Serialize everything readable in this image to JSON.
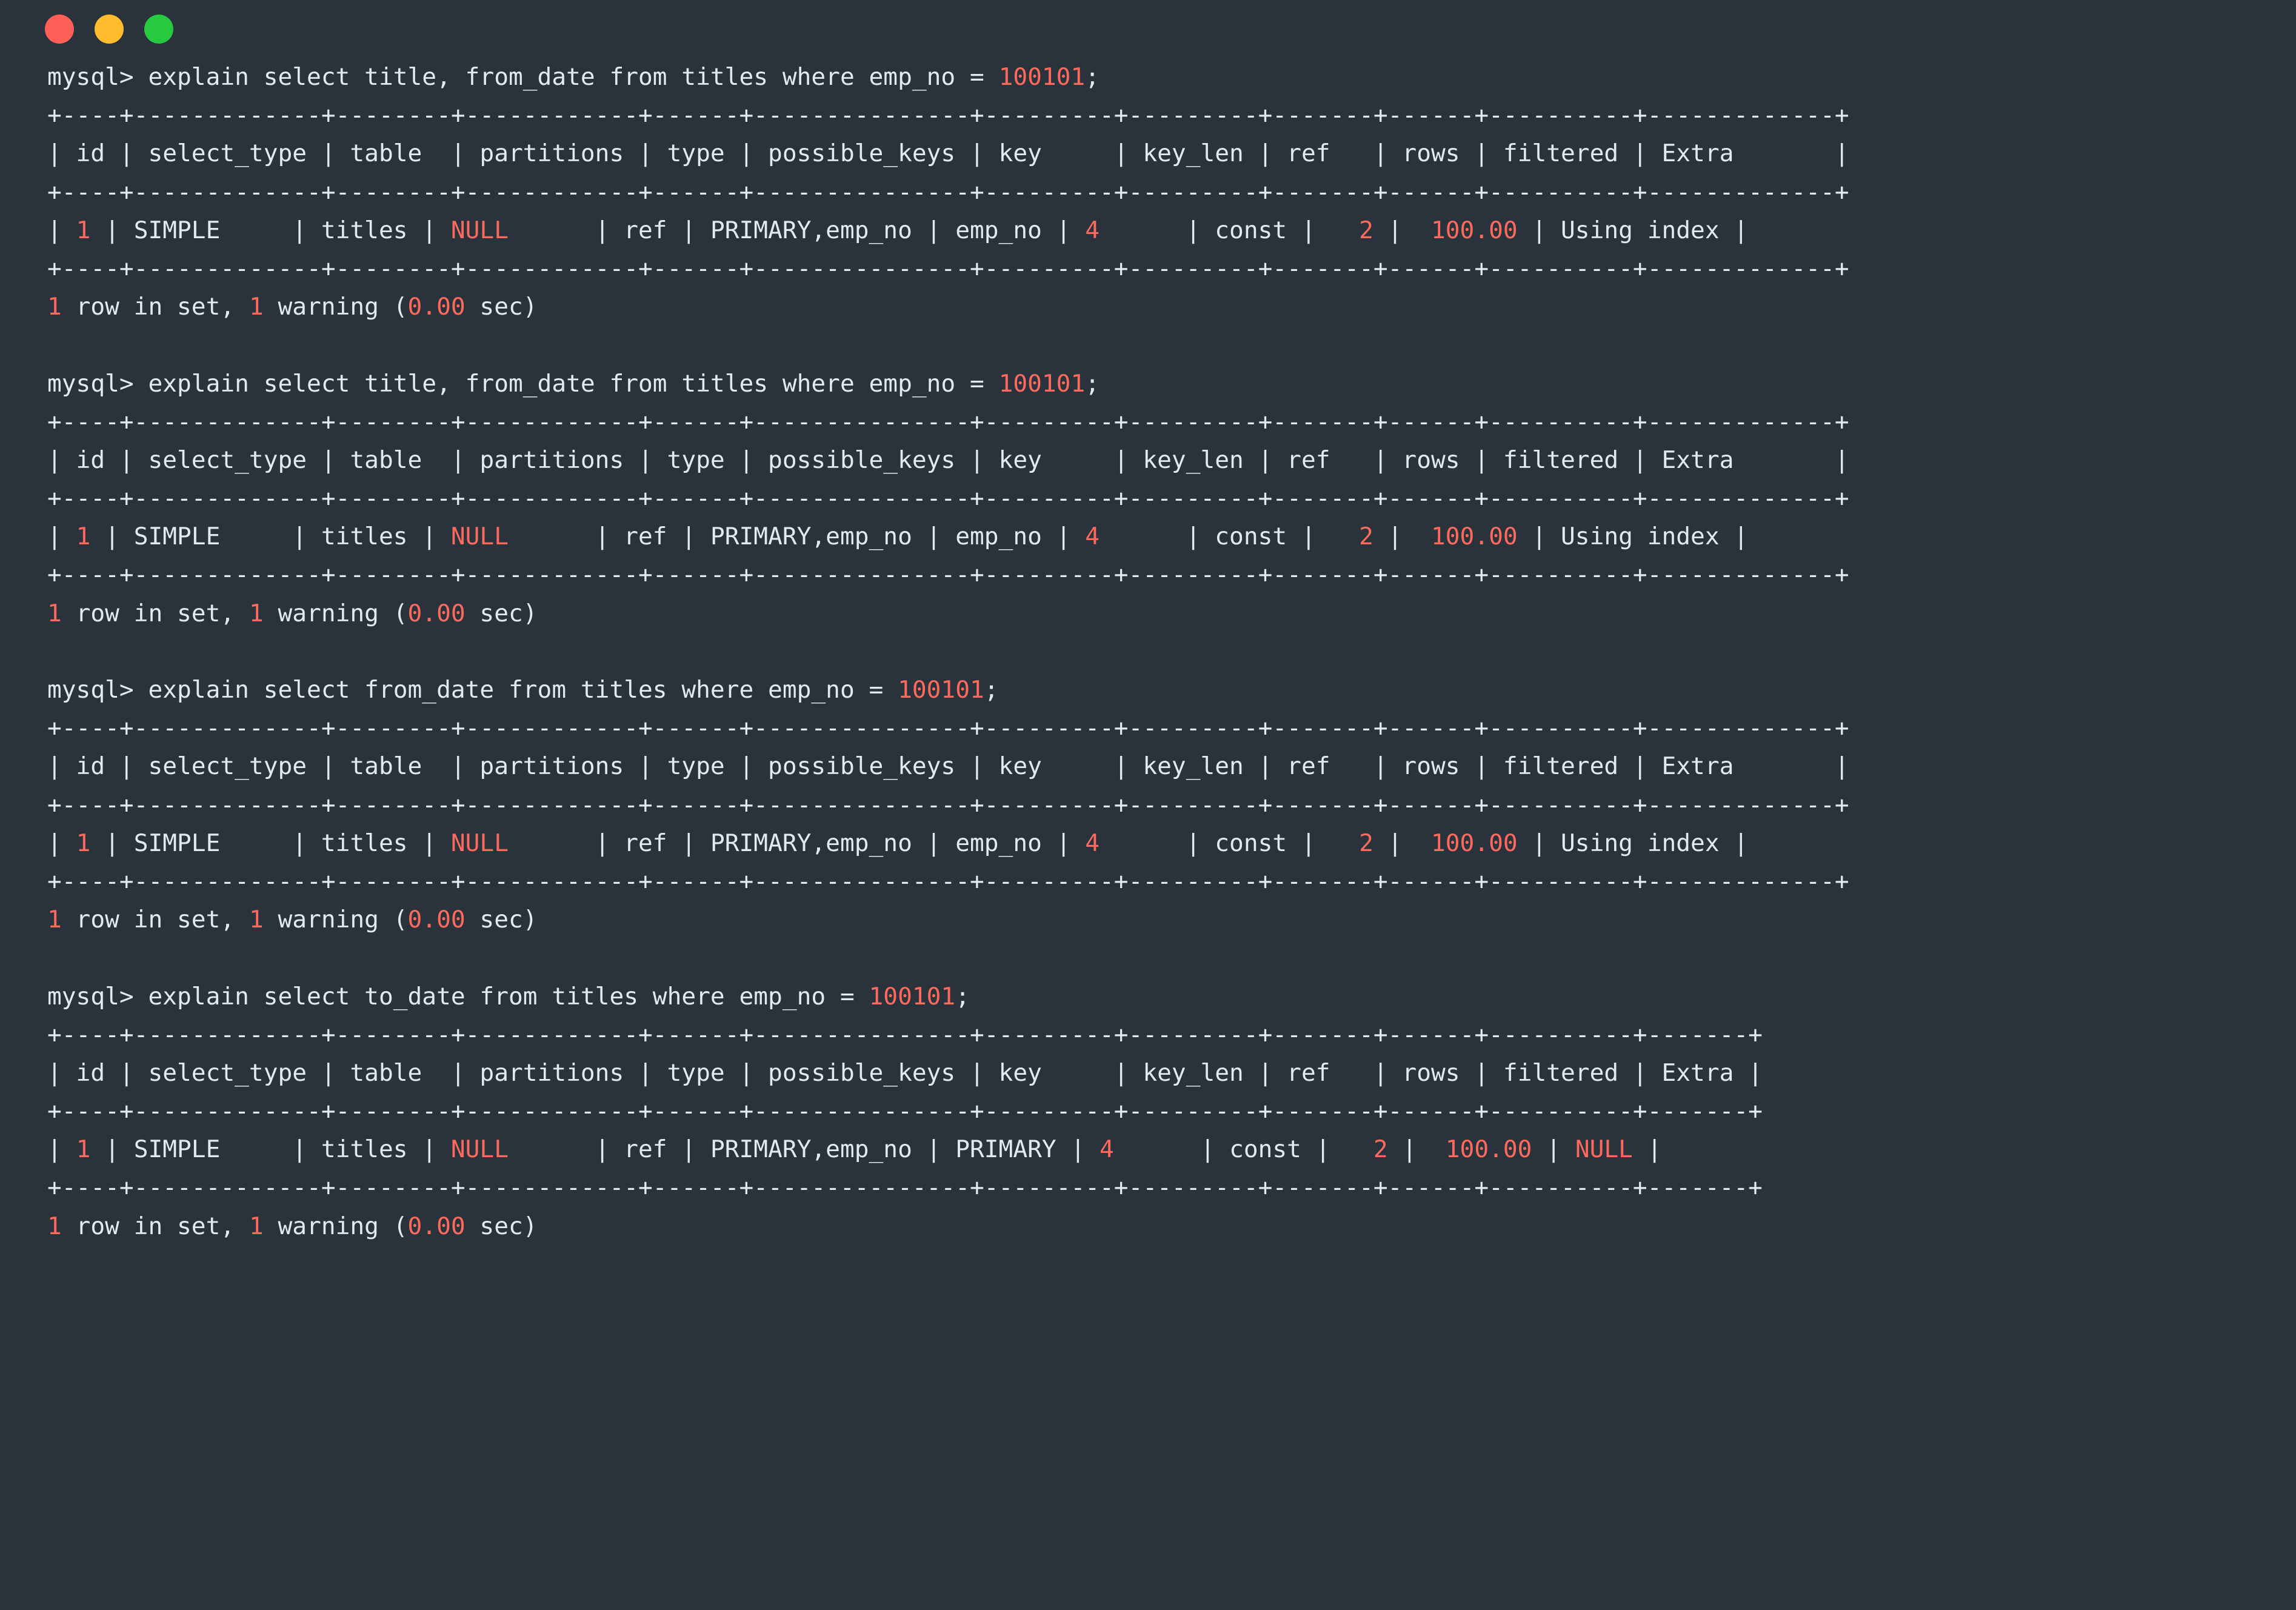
{
  "window": {
    "title": "",
    "controls": [
      {
        "name": "close",
        "color": "#ff5f56"
      },
      {
        "name": "minimize",
        "color": "#ffbd2e"
      },
      {
        "name": "maximize",
        "color": "#27c93f"
      }
    ],
    "background_color": "#2a333b",
    "text_color": "#e3e9ec",
    "value_color": "#fc6a5d"
  },
  "terminal": {
    "prompt": "mysql> ",
    "blocks": [
      {
        "command": "explain select title, from_date from titles where emp_no = ",
        "command_value": "100101",
        "command_end": ";",
        "separator": "+----+-------------+--------+------------+------+---------------+---------+---------+-------+------+----------+-------------+",
        "header": "| id | select_type | table  | partitions | type | possible_keys | key     | key_len | ref   | rows | filtered | Extra       |",
        "columns": [
          "id",
          "select_type",
          "table",
          "partitions",
          "type",
          "possible_keys",
          "key",
          "key_len",
          "ref",
          "rows",
          "filtered",
          "Extra"
        ],
        "row": {
          "id": "1",
          "select_type": "SIMPLE",
          "table": "titles",
          "partitions": "NULL",
          "type": "ref",
          "possible_keys": "PRIMARY,emp_no",
          "key": "emp_no",
          "key_len": "4",
          "ref": "const",
          "rows": "2",
          "filtered": "100.00",
          "extra": "Using index"
        },
        "status_count": "1",
        "status_mid": " row in set, ",
        "status_warnings": "1",
        "status_warn_text": " warning (",
        "status_time": "0.00",
        "status_end": " sec)"
      },
      {
        "command": "explain select title, from_date from titles where emp_no = ",
        "command_value": "100101",
        "command_end": ";",
        "separator": "+----+-------------+--------+------------+------+---------------+---------+---------+-------+------+----------+-------------+",
        "header": "| id | select_type | table  | partitions | type | possible_keys | key     | key_len | ref   | rows | filtered | Extra       |",
        "columns": [
          "id",
          "select_type",
          "table",
          "partitions",
          "type",
          "possible_keys",
          "key",
          "key_len",
          "ref",
          "rows",
          "filtered",
          "Extra"
        ],
        "row": {
          "id": "1",
          "select_type": "SIMPLE",
          "table": "titles",
          "partitions": "NULL",
          "type": "ref",
          "possible_keys": "PRIMARY,emp_no",
          "key": "emp_no",
          "key_len": "4",
          "ref": "const",
          "rows": "2",
          "filtered": "100.00",
          "extra": "Using index"
        },
        "status_count": "1",
        "status_mid": " row in set, ",
        "status_warnings": "1",
        "status_warn_text": " warning (",
        "status_time": "0.00",
        "status_end": " sec)"
      },
      {
        "command": "explain select from_date from titles where emp_no = ",
        "command_value": "100101",
        "command_end": ";",
        "separator": "+----+-------------+--------+------------+------+---------------+---------+---------+-------+------+----------+-------------+",
        "header": "| id | select_type | table  | partitions | type | possible_keys | key     | key_len | ref   | rows | filtered | Extra       |",
        "columns": [
          "id",
          "select_type",
          "table",
          "partitions",
          "type",
          "possible_keys",
          "key",
          "key_len",
          "ref",
          "rows",
          "filtered",
          "Extra"
        ],
        "row": {
          "id": "1",
          "select_type": "SIMPLE",
          "table": "titles",
          "partitions": "NULL",
          "type": "ref",
          "possible_keys": "PRIMARY,emp_no",
          "key": "emp_no",
          "key_len": "4",
          "ref": "const",
          "rows": "2",
          "filtered": "100.00",
          "extra": "Using index"
        },
        "status_count": "1",
        "status_mid": " row in set, ",
        "status_warnings": "1",
        "status_warn_text": " warning (",
        "status_time": "0.00",
        "status_end": " sec)"
      },
      {
        "command": "explain select to_date from titles where emp_no = ",
        "command_value": "100101",
        "command_end": ";",
        "separator": "+----+-------------+--------+------------+------+---------------+---------+---------+-------+------+----------+-------+",
        "header": "| id | select_type | table  | partitions | type | possible_keys | key     | key_len | ref   | rows | filtered | Extra |",
        "columns": [
          "id",
          "select_type",
          "table",
          "partitions",
          "type",
          "possible_keys",
          "key",
          "key_len",
          "ref",
          "rows",
          "filtered",
          "Extra"
        ],
        "row": {
          "id": "1",
          "select_type": "SIMPLE",
          "table": "titles",
          "partitions": "NULL",
          "type": "ref",
          "possible_keys": "PRIMARY,emp_no",
          "key": "PRIMARY",
          "key_len": "4",
          "ref": "const",
          "rows": "2",
          "filtered": "100.00",
          "extra": "NULL"
        },
        "status_count": "1",
        "status_mid": " row in set, ",
        "status_warnings": "1",
        "status_warn_text": " warning (",
        "status_time": "0.00",
        "status_end": " sec)"
      }
    ]
  }
}
